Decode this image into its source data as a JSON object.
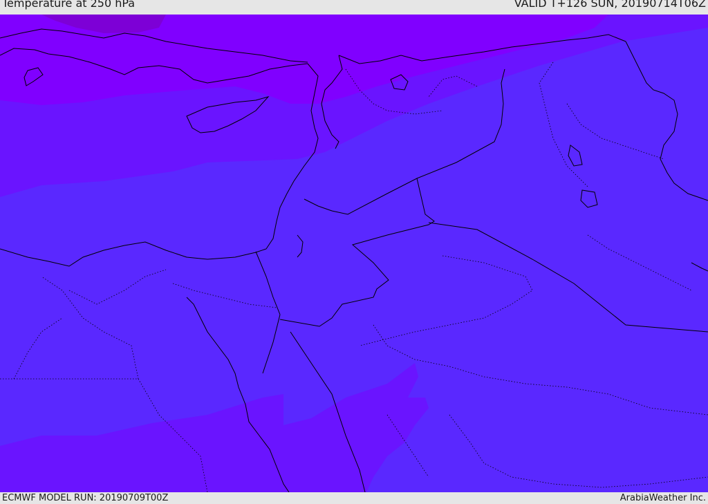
{
  "header": {
    "title": "Temperature at 250 hPa",
    "valid": "VALID T+126 SUN, 20190714T06Z"
  },
  "footer": {
    "model_run": "ECMWF MODEL RUN: 20190709T00Z",
    "credit": "ArabiaWeather Inc."
  },
  "colors": {
    "band_coldest": "#7d00d6",
    "band_cold": "#8000ff",
    "band_mid": "#6a14ff",
    "band_main": "#5a28ff",
    "coastline": "#000000",
    "border": "#000000"
  }
}
